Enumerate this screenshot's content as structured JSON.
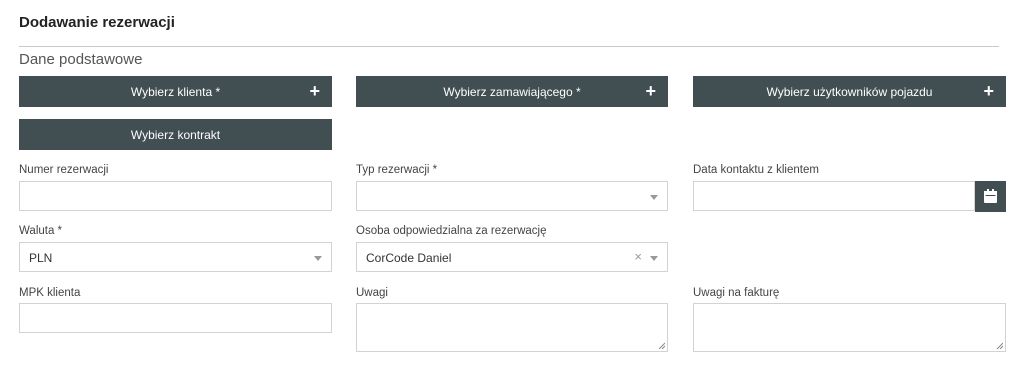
{
  "header": {
    "title": "Dodawanie rezerwacji",
    "section": "Dane podstawowe"
  },
  "buttons": {
    "choose_client": "Wybierz klienta *",
    "choose_orderer": "Wybierz zamawiającego *",
    "choose_vehicle_users": "Wybierz użytkowników pojazdu",
    "choose_contract": "Wybierz kontrakt",
    "plus_glyph": "+"
  },
  "fields": {
    "reservation_number": {
      "label": "Numer rezerwacji",
      "value": ""
    },
    "reservation_type": {
      "label": "Typ rezerwacji *",
      "value": ""
    },
    "client_contact_date": {
      "label": "Data kontaktu z klientem",
      "value": ""
    },
    "currency": {
      "label": "Waluta *",
      "value": "PLN"
    },
    "responsible_person": {
      "label": "Osoba odpowiedzialna za rezerwację",
      "value": "CorCode Daniel",
      "clear_glyph": "×"
    },
    "client_mpk": {
      "label": "MPK klienta",
      "value": ""
    },
    "notes": {
      "label": "Uwagi",
      "value": ""
    },
    "invoice_notes": {
      "label": "Uwagi na fakturę",
      "value": ""
    }
  },
  "icons": {
    "calendar": "calendar-icon",
    "dropdown": "chevron-down-icon",
    "add": "plus-icon",
    "clear": "close-icon"
  },
  "colors": {
    "button_bg": "#414e52",
    "button_text": "#ffffff",
    "border": "#d2d2d2"
  }
}
